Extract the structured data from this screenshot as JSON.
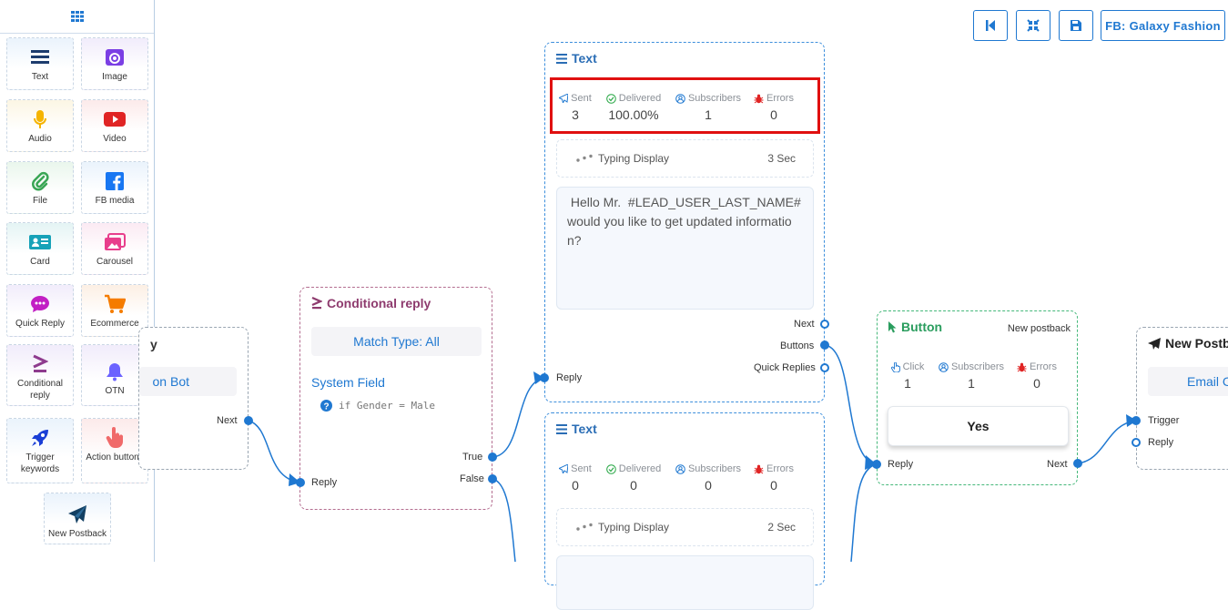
{
  "toolbar": {
    "page_label": "FB: Galaxy Fashion",
    "colors": {
      "accent": "#1f78d1"
    }
  },
  "palette": {
    "items": [
      {
        "label": "Text",
        "icon": "text-lines-icon"
      },
      {
        "label": "Image",
        "icon": "image-icon"
      },
      {
        "label": "Audio",
        "icon": "microphone-icon"
      },
      {
        "label": "Video",
        "icon": "video-icon"
      },
      {
        "label": "File",
        "icon": "paperclip-icon"
      },
      {
        "label": "FB media",
        "icon": "facebook-icon"
      },
      {
        "label": "Card",
        "icon": "card-icon"
      },
      {
        "label": "Carousel",
        "icon": "carousel-icon"
      },
      {
        "label": "Quick Reply",
        "icon": "chat-bubble-icon"
      },
      {
        "label": "Ecommerce",
        "icon": "cart-icon"
      },
      {
        "label": "Conditional reply",
        "icon": "condition-icon"
      },
      {
        "label": "OTN",
        "icon": "bell-icon"
      },
      {
        "label": "Trigger keywords",
        "icon": "rocket-icon"
      },
      {
        "label": "Action buttons",
        "icon": "hand-pointer-icon"
      },
      {
        "label": "New Postback",
        "icon": "paper-plane-icon"
      }
    ]
  },
  "left_node": {
    "title_partial": "y",
    "pill": "on Bot",
    "next_label": "Next"
  },
  "conditional": {
    "title": "Conditional reply",
    "match": "Match Type: All",
    "field": "System Field",
    "condition": "if Gender = Male",
    "true_label": "True",
    "false_label": "False",
    "reply_label": "Reply"
  },
  "text1": {
    "title": "Text",
    "stats": [
      {
        "label": "Sent",
        "value": "3"
      },
      {
        "label": "Delivered",
        "value": "100.00%"
      },
      {
        "label": "Subscribers",
        "value": "1"
      },
      {
        "label": "Errors",
        "value": "0"
      }
    ],
    "typing_label": "Typing Display",
    "typing_time": "3 Sec",
    "message": " Hello Mr.  #LEAD_USER_LAST_NAME#\nwould you like to get updated informatio\nn?",
    "next_label": "Next",
    "buttons_label": "Buttons",
    "quick_label": "Quick Replies",
    "reply_label": "Reply"
  },
  "text2": {
    "title": "Text",
    "stats": [
      {
        "label": "Sent",
        "value": "0"
      },
      {
        "label": "Delivered",
        "value": "0"
      },
      {
        "label": "Subscribers",
        "value": "0"
      },
      {
        "label": "Errors",
        "value": "0"
      }
    ],
    "typing_label": "Typing Display",
    "typing_time": "2 Sec"
  },
  "button_node": {
    "title": "Button",
    "postback": "New postback",
    "stats": [
      {
        "label": "Click",
        "value": "1"
      },
      {
        "label": "Subscribers",
        "value": "1"
      },
      {
        "label": "Errors",
        "value": "0"
      }
    ],
    "button_label": "Yes",
    "reply_label": "Reply",
    "next_label": "Next"
  },
  "postback_node": {
    "title": "New Postba",
    "pill": "Email Co",
    "trigger_label": "Trigger",
    "reply_label": "Reply"
  }
}
